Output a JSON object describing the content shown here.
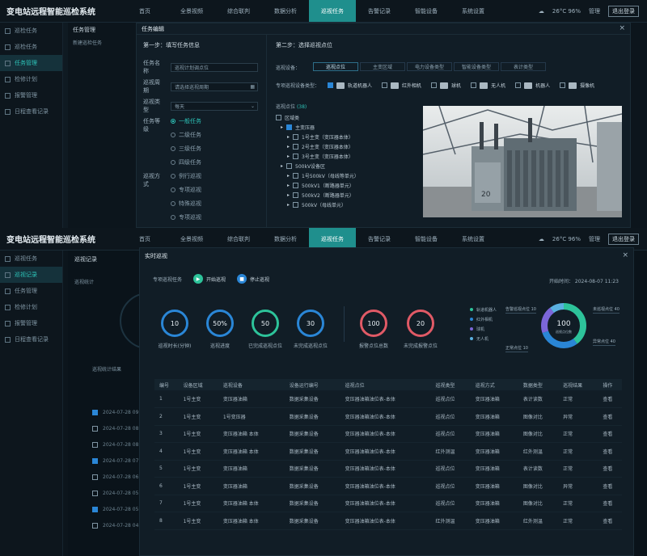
{
  "app": {
    "title": "变电站远程智能巡检系统"
  },
  "nav": {
    "items": [
      "首页",
      "全景视频",
      "综合联判",
      "数据分析",
      "巡视任务",
      "告警记录",
      "智能设备",
      "系统设置"
    ],
    "active_index": 4
  },
  "toolbar": {
    "weather": "26°C 96%",
    "user": "管理",
    "logout": "退出登录"
  },
  "sidebar_top": {
    "items": [
      "巡检任务",
      "巡检任务",
      "任务管理",
      "检修计划",
      "报警管理",
      "日程查看记录"
    ],
    "active_index": 2
  },
  "bg_top": {
    "title": "任务管理",
    "sub": "新建巡检任务"
  },
  "task_modal": {
    "title": "任务编辑",
    "step1": "第一步：填写任务信息",
    "step2": "第二步：选择巡视点位",
    "fields": [
      {
        "label": "任务名称",
        "value": "巡视计划调点位"
      },
      {
        "label": "巡视周期",
        "value": "请选择巡视周期"
      },
      {
        "label": "巡视类型",
        "value": "每天"
      }
    ],
    "priority_label": "任务等级",
    "priority_options": [
      "一般任务",
      "二级任务",
      "三级任务",
      "四级任务"
    ],
    "mode_label": "巡视方式",
    "mode_options": [
      "例行巡视",
      "专项巡视",
      "特殊巡视",
      "专项巡视"
    ],
    "device_label": "巡视设备：",
    "segments": [
      "巡视点位",
      "主变区域",
      "电力设备类型",
      "智能设备类型",
      "表计类型"
    ],
    "robot_label": "专项巡视设备类型：",
    "robots": [
      "轨道机器人",
      "红外相机",
      "球机",
      "无人机",
      "机器人",
      "摄像机"
    ],
    "tree_header": "巡视点位",
    "tree": [
      "区域类",
      "主变压器",
      "1号主变（变压器本体）",
      "2号主变（变压器本体）",
      "3号主变（变压器本体）",
      "500kV设备区",
      "1号500kV（母线等单元）",
      "500kV1（断路器单元）",
      "500kV2（断路器单元）",
      "500kV（母线单元）"
    ]
  },
  "sidebar_bottom": {
    "items": [
      "巡视任务",
      "巡视记录",
      "任务管理",
      "检修计划",
      "报警管理",
      "日程查看记录"
    ],
    "active_index": 1
  },
  "bg_bottom": {
    "title": "巡视记录",
    "sub": "巡视统计",
    "list_header": "巡视统计结果"
  },
  "realtime_modal": {
    "title": "实时巡视",
    "task_label": "专项巡视任务",
    "btn_start": "开始巡视",
    "btn_stop": "停止巡视",
    "time_label": "开始时间",
    "time_value": "2024-08-07 11:23",
    "rings": [
      {
        "value": "10",
        "label": "巡视时长(分钟)",
        "color": "#2a86d6"
      },
      {
        "value": "50%",
        "label": "巡视进度",
        "color": "#2a86d6"
      },
      {
        "value": "50",
        "label": "已完成巡视点位",
        "color": "#2dc39a"
      },
      {
        "value": "30",
        "label": "未完成巡视点位",
        "color": "#2a86d6"
      },
      {
        "value": "100",
        "label": "报警点位总数",
        "color": "#e05a66"
      },
      {
        "value": "20",
        "label": "未完成报警点位",
        "color": "#e05a66"
      }
    ],
    "legend": [
      "轨道机器人",
      "红外相机",
      "球机",
      "无人机"
    ],
    "donut_center": "100",
    "donut_sub": "巡视点位数",
    "callouts": [
      "告警巡视点位 10",
      "未巡视点位 40",
      "异常点位 40",
      "正常点位 10"
    ],
    "table_headers": [
      "编号",
      "设备区域",
      "巡视设备",
      "设备运行编号",
      "巡视点位",
      "巡视类型",
      "巡视方式",
      "数据类型",
      "巡视结果",
      "操作"
    ],
    "rows": [
      [
        "1",
        "1号主变",
        "变压器油箱",
        "数据采集设备",
        "变压器油箱油位表-本体",
        "巡视点位",
        "变压器油箱",
        "表计读数",
        "正常",
        "查看"
      ],
      [
        "2",
        "1号主变",
        "1号变压器",
        "数据采集设备",
        "变压器油箱油位表-本体",
        "巡视点位",
        "变压器油箱",
        "图像对比",
        "异常",
        "查看"
      ],
      [
        "3",
        "1号主变",
        "变压器油箱 本体",
        "数据采集设备",
        "变压器油箱油位表-本体",
        "巡视点位",
        "变压器油箱",
        "图像对比",
        "正常",
        "查看"
      ],
      [
        "4",
        "1号主变",
        "变压器油箱 本体",
        "数据采集设备",
        "变压器油箱油位表-本体",
        "红外测温",
        "变压器油箱",
        "红外测温",
        "正常",
        "查看"
      ],
      [
        "5",
        "1号主变",
        "变压器油箱",
        "数据采集设备",
        "变压器油箱油位表-本体",
        "巡视点位",
        "变压器油箱",
        "表计读数",
        "正常",
        "查看"
      ],
      [
        "6",
        "1号主变",
        "变压器油箱",
        "数据采集设备",
        "变压器油箱油位表-本体",
        "巡视点位",
        "变压器油箱",
        "图像对比",
        "异常",
        "查看"
      ],
      [
        "7",
        "1号主变",
        "变压器油箱 本体",
        "数据采集设备",
        "变压器油箱油位表-本体",
        "巡视点位",
        "变压器油箱",
        "图像对比",
        "正常",
        "查看"
      ],
      [
        "8",
        "1号主变",
        "变压器油箱 本体",
        "数据采集设备",
        "变压器油箱油位表-本体",
        "红外测温",
        "变压器油箱",
        "红外测温",
        "正常",
        "查看"
      ]
    ],
    "status_colors": {
      "正常": "#2dc39a",
      "异常": "#e05a66"
    },
    "date_list": [
      "2024-07-28 09",
      "2024-07-28 08",
      "2024-07-28 08",
      "2024-07-28 07",
      "2024-07-28 06",
      "2024-07-28 05",
      "2024-07-28 05",
      "2024-07-28 04"
    ]
  }
}
